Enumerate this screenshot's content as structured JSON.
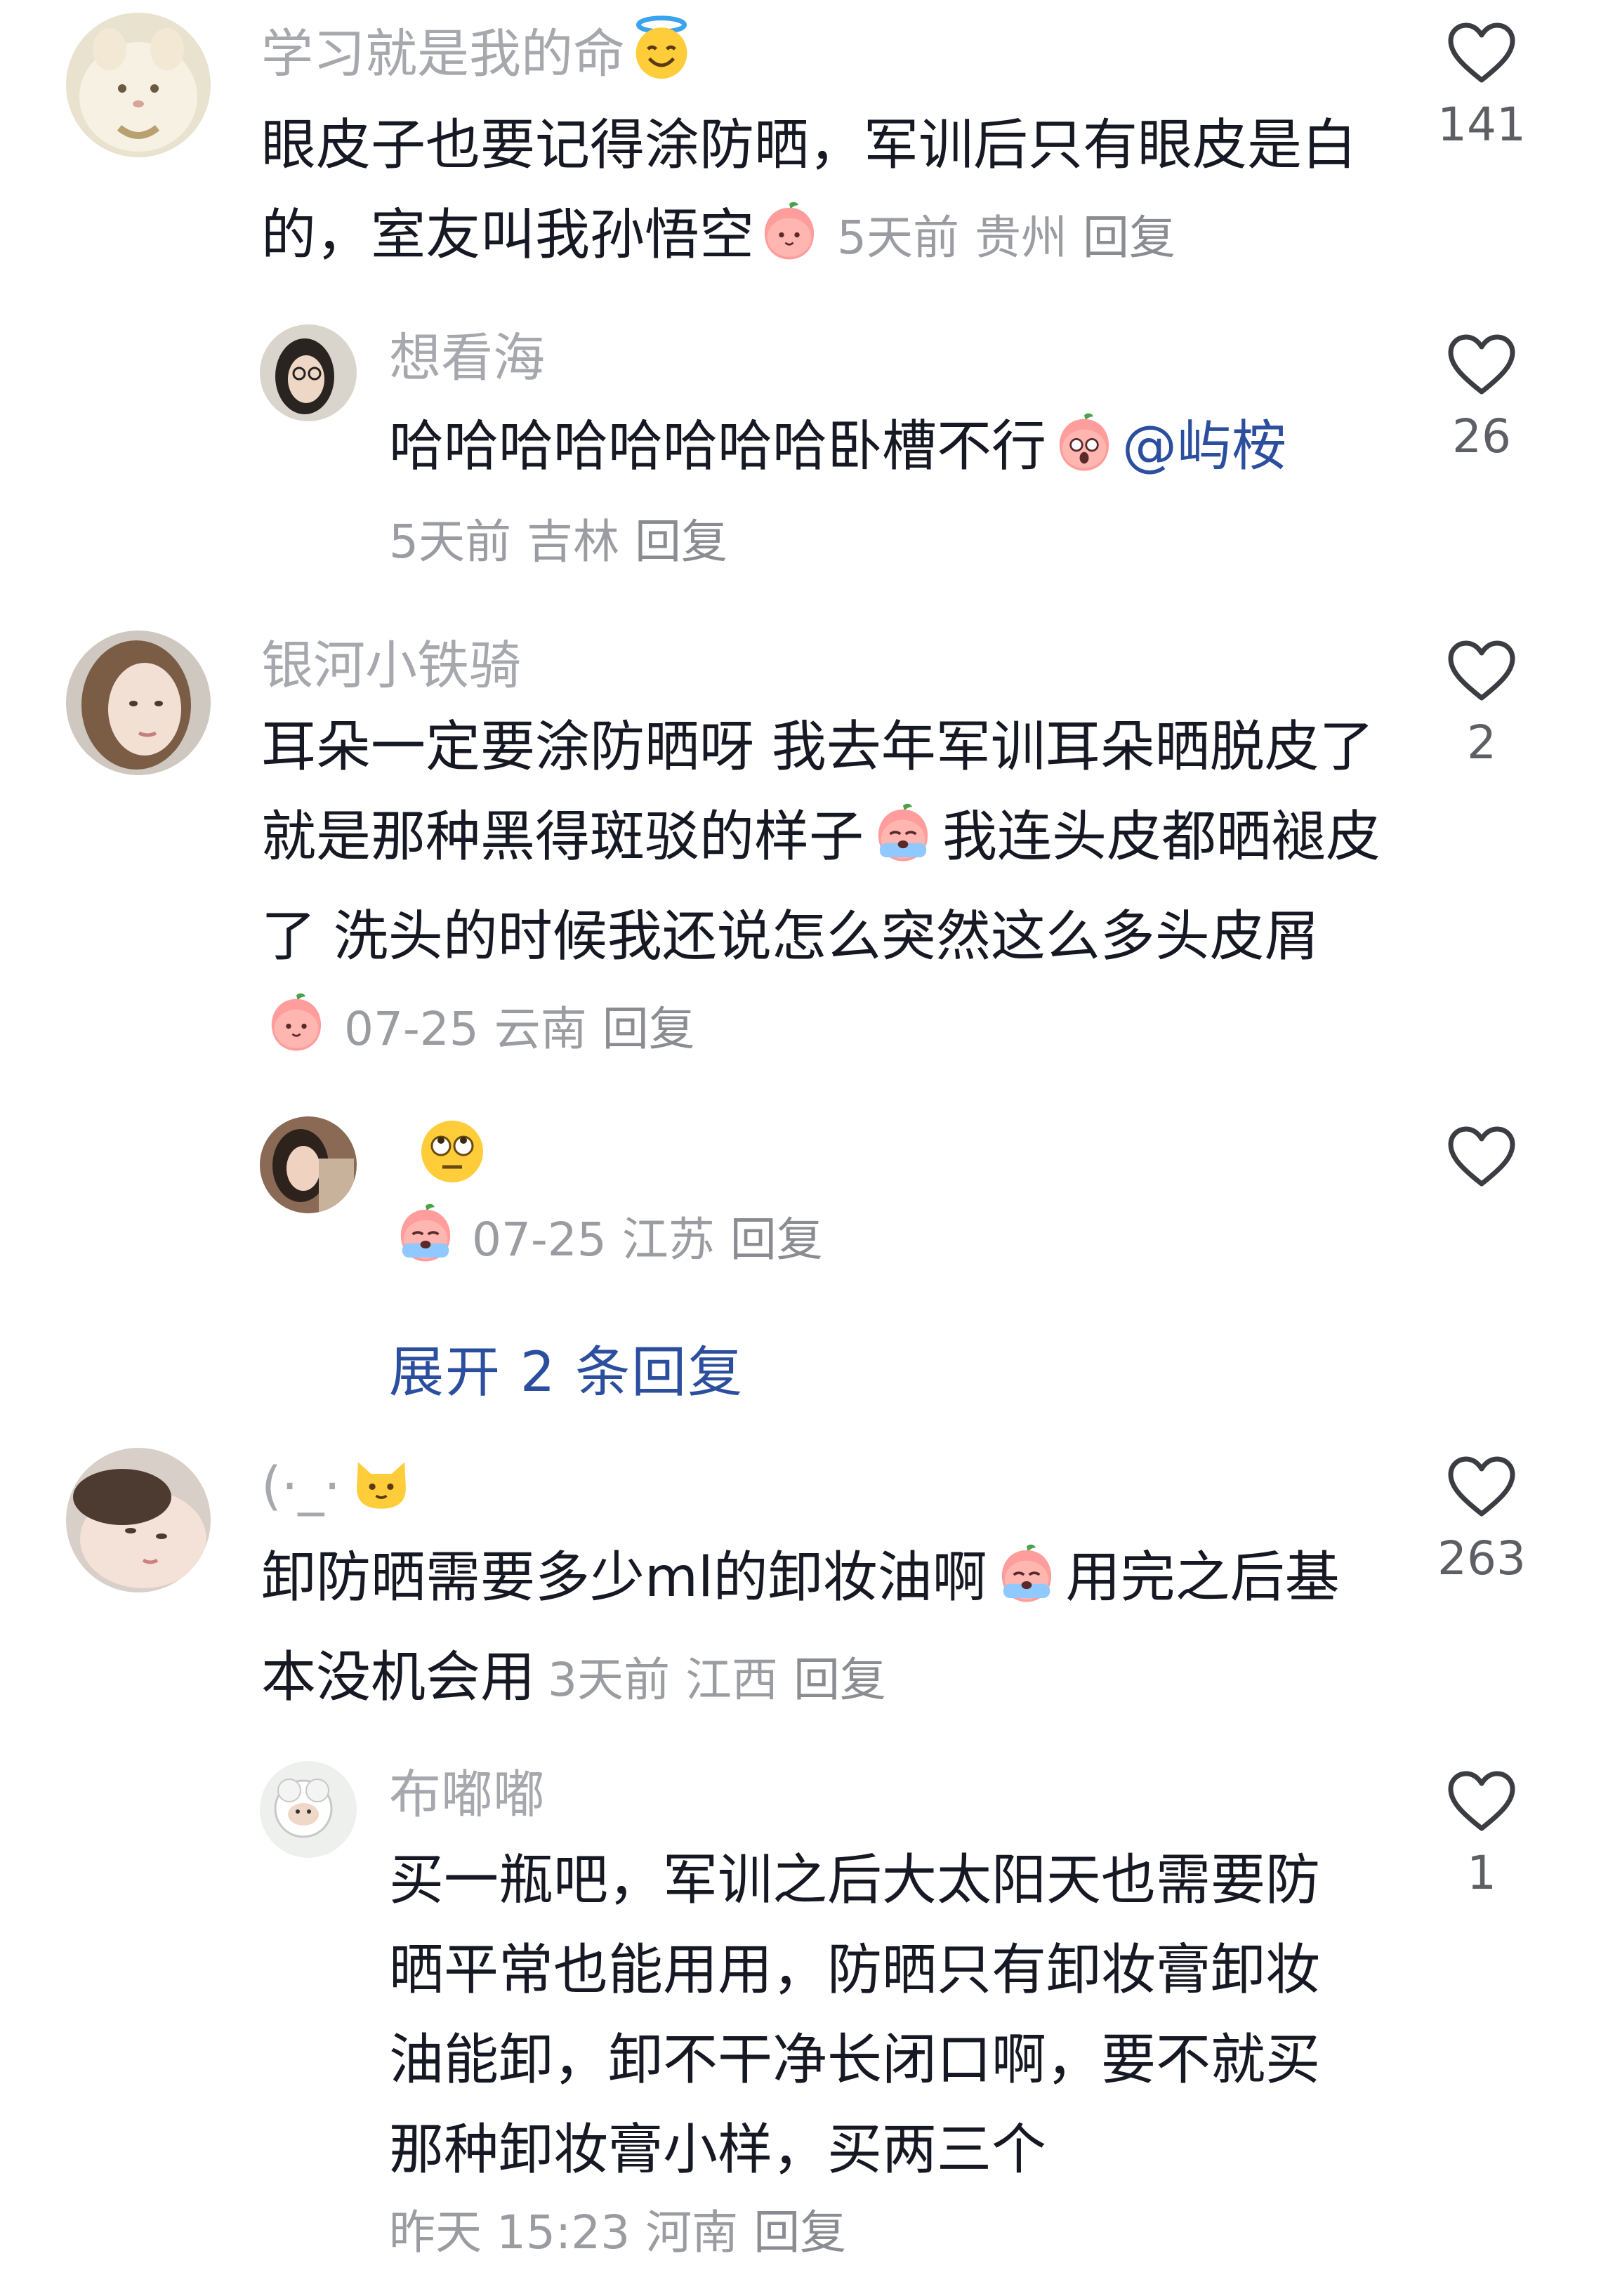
{
  "comments": [
    {
      "username": "学习就是我的命",
      "text": "眼皮子也要记得涂防晒，军训后只有眼皮是白的，室友叫我孙悟空",
      "time": "5天前",
      "location": "贵州",
      "reply": "回复",
      "likes": "141"
    },
    {
      "username": "想看海",
      "text": "哈哈哈哈哈哈哈哈卧槽不行",
      "mention": "@屿桉",
      "time": "5天前",
      "location": "吉林",
      "reply": "回复",
      "likes": "26"
    },
    {
      "username": "银河小铁骑",
      "text_part1": "耳朵一定要涂防晒呀 我去年军训耳朵晒脱皮了 就是那种黑得斑驳的样子",
      "text_part2": "我连头皮都晒褪皮了 洗头的时候我还说怎么突然这么多头皮屑",
      "time": "07-25",
      "location": "云南",
      "reply": "回复",
      "likes": "2"
    },
    {
      "username": "",
      "time": "07-25",
      "location": "江苏",
      "reply": "回复",
      "likes": ""
    },
    {
      "expand_label": "展开 2 条回复"
    },
    {
      "username": "(·_·",
      "text_part1": "卸防晒需要多少ml的卸妆油啊",
      "text_part2": "用完之后基本没机会用",
      "time": "3天前",
      "location": "江西",
      "reply": "回复",
      "likes": "263"
    },
    {
      "username": "布嘟嘟",
      "text": "买一瓶吧，军训之后大太阳天也需要防晒平常也能用用，防晒只有卸妆膏卸妆油能卸，卸不干净长闭口啊，要不就买那种卸妆膏小样，买两三个",
      "time": "昨天 15:23",
      "location": "河南",
      "reply": "回复",
      "likes": "1"
    }
  ],
  "icons": {
    "like": "heart-outline-icon",
    "emoji_halo": "smiling-face-with-halo-icon",
    "emoji_blush": "blushing-peach-face-icon",
    "emoji_shock": "shocked-peach-face-icon",
    "emoji_cry": "crying-peach-face-icon",
    "emoji_rolleyes": "rolling-eyes-face-icon",
    "emoji_cat": "cat-face-icon"
  },
  "colors": {
    "text": "#161823",
    "muted": "#a6a8ad",
    "link": "#2b4f9e",
    "heart": "#3b3d43"
  }
}
